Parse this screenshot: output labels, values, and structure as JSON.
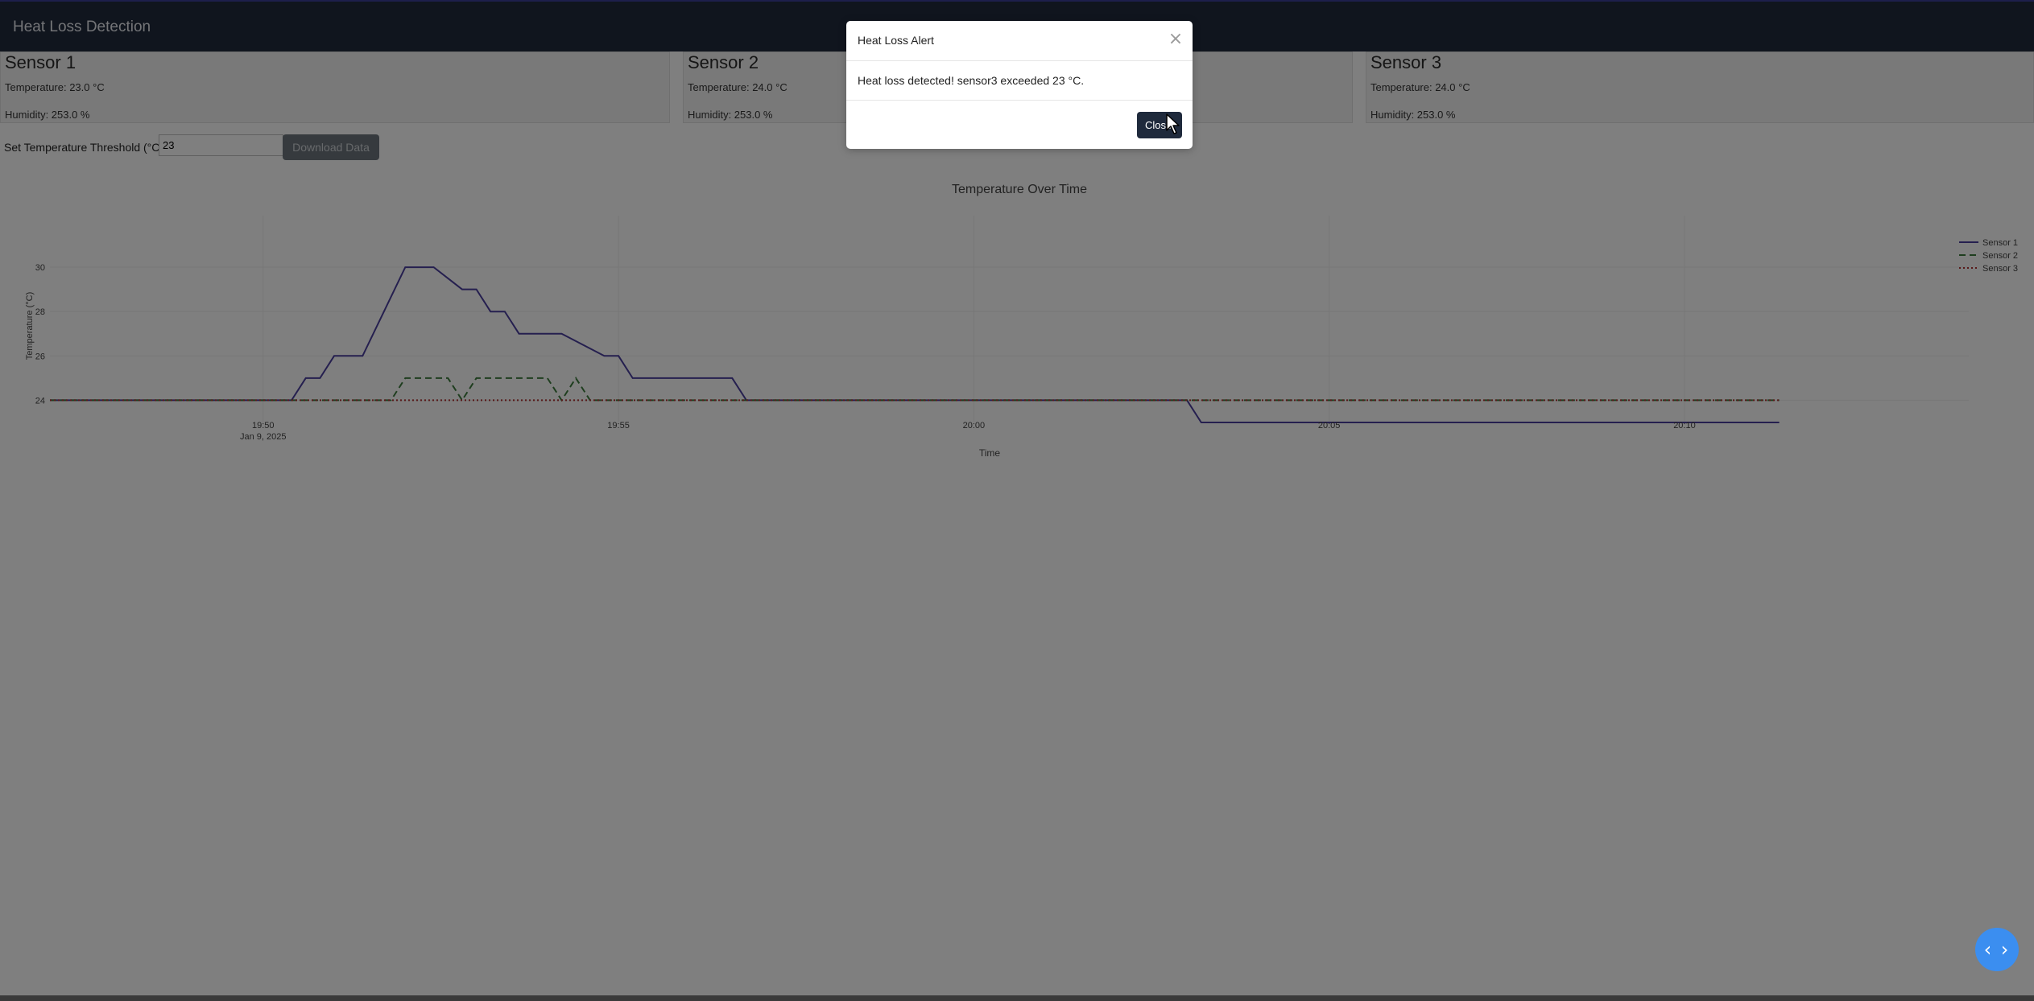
{
  "app": {
    "title": "Heat Loss Detection"
  },
  "sensors": [
    {
      "name": "Sensor 1",
      "temperature": "Temperature: 23.0 °C",
      "humidity": "Humidity: 253.0 %"
    },
    {
      "name": "Sensor 2",
      "temperature": "Temperature: 24.0 °C",
      "humidity": "Humidity: 253.0 %"
    },
    {
      "name": "Sensor 3",
      "temperature": "Temperature: 24.0 °C",
      "humidity": "Humidity: 253.0 %"
    }
  ],
  "controls": {
    "threshold_label": "Set Temperature Threshold (°C):",
    "threshold_value": "23",
    "download_label": "Download Data"
  },
  "chart_data": {
    "type": "line",
    "title": "Temperature Over Time",
    "xlabel": "Time",
    "ylabel": "Temperature (°C)",
    "ylim": [
      23,
      30.8
    ],
    "x_tick_labels": [
      {
        "t": "19:50",
        "sub": "Jan 9, 2025"
      },
      {
        "t": "19:55",
        "sub": ""
      },
      {
        "t": "20:00",
        "sub": ""
      },
      {
        "t": "20:05",
        "sub": ""
      },
      {
        "t": "20:10",
        "sub": ""
      }
    ],
    "y_ticks": [
      24,
      26,
      28,
      30
    ],
    "grid": true,
    "legend_position": "top-right",
    "series": [
      {
        "name": "Sensor 1",
        "color": "#4b3f9e",
        "dash": "solid",
        "x": [
          "19:47:00",
          "19:50:24",
          "19:50:36",
          "19:50:48",
          "19:51:00",
          "19:51:24",
          "19:52:00",
          "19:52:24",
          "19:52:48",
          "19:53:00",
          "19:53:12",
          "19:53:24",
          "19:53:36",
          "19:54:00",
          "19:54:12",
          "19:54:48",
          "19:55:00",
          "19:55:12",
          "19:56:36",
          "19:56:48",
          "20:03:00",
          "20:03:12",
          "20:11:20"
        ],
        "y": [
          24,
          24,
          25,
          25,
          26,
          26,
          30,
          30,
          29,
          29,
          28,
          28,
          27,
          27,
          27,
          26,
          26,
          25,
          25,
          24,
          24,
          23,
          23
        ]
      },
      {
        "name": "Sensor 2",
        "color": "#3f7d3f",
        "dash": "dashed",
        "x": [
          "19:47:00",
          "19:51:48",
          "19:52:00",
          "19:52:24",
          "19:52:36",
          "19:52:48",
          "19:53:00",
          "19:53:12",
          "19:53:24",
          "19:53:36",
          "19:54:00",
          "19:54:12",
          "19:54:24",
          "19:54:36",
          "20:11:20"
        ],
        "y": [
          24,
          24,
          25,
          25,
          25,
          24,
          25,
          25,
          25,
          25,
          25,
          24,
          25,
          24,
          24
        ]
      },
      {
        "name": "Sensor 3",
        "color": "#b03030",
        "dash": "dotted",
        "x": [
          "19:47:00",
          "20:11:20"
        ],
        "y": [
          24,
          24
        ]
      }
    ]
  },
  "modal": {
    "title": "Heat Loss Alert",
    "close_icon": "×",
    "message": "Heat loss detected! sensor3 exceeded 23 °C.",
    "button_label": "Close"
  },
  "fab": {
    "icon": "code-icon",
    "glyph": "‹ ›"
  }
}
